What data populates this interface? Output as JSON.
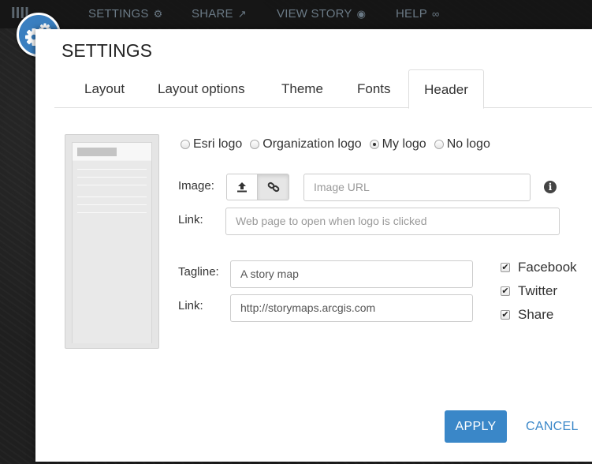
{
  "topbar": {
    "brand": "IIII",
    "settings": "SETTINGS",
    "share": "SHARE",
    "view_story": "VIEW STORY",
    "help": "HELP"
  },
  "modal": {
    "title": "SETTINGS",
    "tabs": [
      {
        "label": "Layout",
        "active": false
      },
      {
        "label": "Layout options",
        "active": false
      },
      {
        "label": "Theme",
        "active": false
      },
      {
        "label": "Fonts",
        "active": false
      },
      {
        "label": "Header",
        "active": true
      }
    ],
    "logo_options": [
      {
        "label": "Esri logo",
        "selected": false
      },
      {
        "label": "Organization logo",
        "selected": false
      },
      {
        "label": "My logo",
        "selected": true
      },
      {
        "label": "No logo",
        "selected": false
      }
    ],
    "image_label": "Image:",
    "image_url_placeholder": "Image URL",
    "link_label": "Link:",
    "link_placeholder": "Web page to open when logo is clicked",
    "tagline_label": "Tagline:",
    "tagline_value": "A story map",
    "tagline_link_label": "Link:",
    "tagline_link_value": "http://storymaps.arcgis.com",
    "social": [
      {
        "label": "Facebook",
        "checked": true
      },
      {
        "label": "Twitter",
        "checked": true
      },
      {
        "label": "Share",
        "checked": true
      }
    ],
    "apply_label": "APPLY",
    "cancel_label": "CANCEL"
  },
  "colors": {
    "accent": "#3a87c8",
    "badge": "#3a7fc0"
  },
  "icons": {
    "badge": "gears-icon",
    "upload": "upload-icon",
    "link": "link-icon",
    "info": "info-icon"
  }
}
